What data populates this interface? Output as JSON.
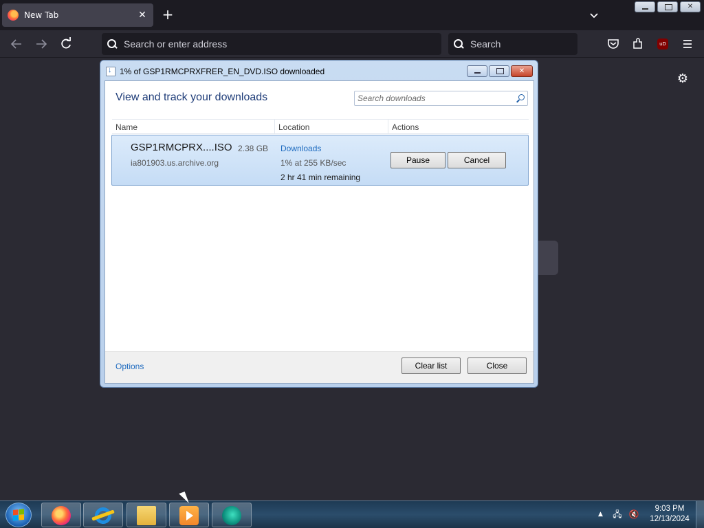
{
  "browser": {
    "tab_title": "New Tab",
    "tab_close": "✕",
    "new_tab": "+",
    "url_placeholder": "Search or enter address",
    "search_placeholder": "Search",
    "ublock_label": "uD"
  },
  "dialog": {
    "title": "1% of GSP1RMCPRXFRER_EN_DVD.ISO downloaded",
    "heading": "View and track your downloads",
    "search_placeholder": "Search downloads",
    "columns": {
      "name": "Name",
      "location": "Location",
      "actions": "Actions"
    },
    "download": {
      "filename": "GSP1RMCPRX....ISO",
      "size": "2.38 GB",
      "host": "ia801903.us.archive.org",
      "location": "Downloads",
      "progress_text": "1% at 255 KB/sec",
      "progress_fraction": 0.01,
      "remaining": "2 hr 41 min remaining",
      "pause_label": "Pause",
      "cancel_label": "Cancel"
    },
    "options_label": "Options",
    "clear_list_label": "Clear list",
    "close_label": "Close"
  },
  "taskbar": {
    "apps": [
      "firefox-icon",
      "internet-explorer-icon",
      "file-explorer-icon",
      "media-player-icon",
      "app-icon"
    ],
    "clock_time": "9:03 PM",
    "clock_date": "12/13/2024"
  }
}
